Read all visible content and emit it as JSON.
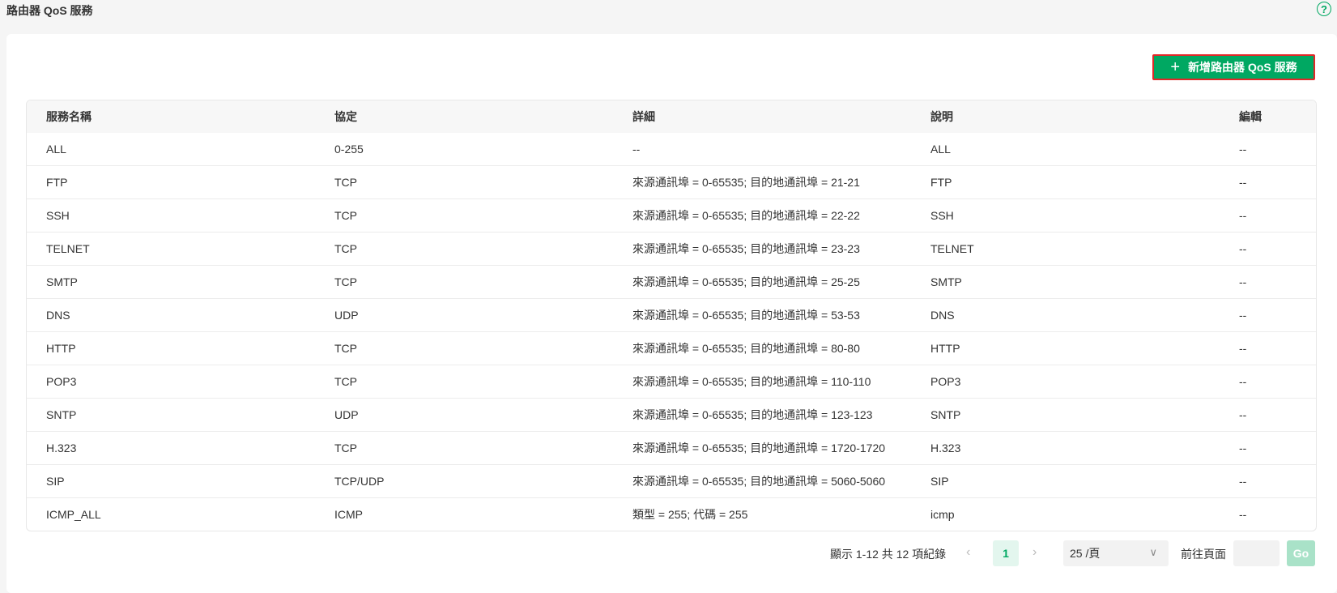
{
  "page": {
    "title": "路由器 QoS 服務",
    "help_icon": "?"
  },
  "toolbar": {
    "add_icon": "+",
    "add_label": "新增路由器 QoS 服務"
  },
  "table": {
    "headers": [
      "服務名稱",
      "協定",
      "詳細",
      "說明",
      "編輯"
    ],
    "rows": [
      [
        "ALL",
        "0-255",
        "--",
        "ALL",
        "--"
      ],
      [
        "FTP",
        "TCP",
        "來源通訊埠 = 0-65535; 目的地通訊埠 = 21-21",
        "FTP",
        "--"
      ],
      [
        "SSH",
        "TCP",
        "來源通訊埠 = 0-65535; 目的地通訊埠 = 22-22",
        "SSH",
        "--"
      ],
      [
        "TELNET",
        "TCP",
        "來源通訊埠 = 0-65535; 目的地通訊埠 = 23-23",
        "TELNET",
        "--"
      ],
      [
        "SMTP",
        "TCP",
        "來源通訊埠 = 0-65535; 目的地通訊埠 = 25-25",
        "SMTP",
        "--"
      ],
      [
        "DNS",
        "UDP",
        "來源通訊埠 = 0-65535; 目的地通訊埠 = 53-53",
        "DNS",
        "--"
      ],
      [
        "HTTP",
        "TCP",
        "來源通訊埠 = 0-65535; 目的地通訊埠 = 80-80",
        "HTTP",
        "--"
      ],
      [
        "POP3",
        "TCP",
        "來源通訊埠 = 0-65535; 目的地通訊埠 = 110-110",
        "POP3",
        "--"
      ],
      [
        "SNTP",
        "UDP",
        "來源通訊埠 = 0-65535; 目的地通訊埠 = 123-123",
        "SNTP",
        "--"
      ],
      [
        "H.323",
        "TCP",
        "來源通訊埠 = 0-65535; 目的地通訊埠 = 1720-1720",
        "H.323",
        "--"
      ],
      [
        "SIP",
        "TCP/UDP",
        "來源通訊埠 = 0-65535; 目的地通訊埠 = 5060-5060",
        "SIP",
        "--"
      ],
      [
        "ICMP_ALL",
        "ICMP",
        "類型 = 255; 代碼 = 255",
        "icmp",
        "--"
      ]
    ]
  },
  "pagination": {
    "info": "顯示 1-12 共 12 項紀錄",
    "prev": "‹",
    "current_page": "1",
    "next": "›",
    "page_size": "25 /頁",
    "page_size_chevron": "∨",
    "goto_label": "前往頁面",
    "goto_value": "",
    "go_label": "Go"
  },
  "colors": {
    "accent": "#00a862",
    "highlight_border": "#e02828"
  }
}
